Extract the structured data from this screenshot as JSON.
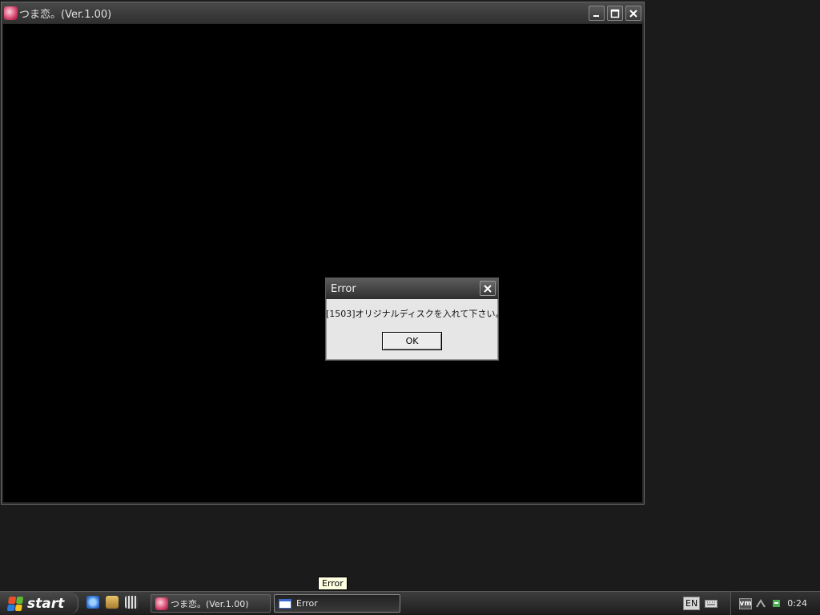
{
  "main_window": {
    "title": "つま恋。(Ver.1.00)"
  },
  "dialog": {
    "title": "Error",
    "message": "[1503]オリジナルディスクを入れて下さい。",
    "ok_label": "OK"
  },
  "tooltip": {
    "text": "Error"
  },
  "taskbar": {
    "start_label": "start",
    "tasks": [
      {
        "label": "つま恋。(Ver.1.00)"
      },
      {
        "label": "Error"
      }
    ],
    "language": "EN",
    "tray_vm_label": "vm",
    "clock": "0:24"
  },
  "colors": {
    "desktop": "#1b1b1b",
    "client_area": "#000000",
    "dialog_body": "#e6e6e6",
    "tooltip_bg": "#ffffe1"
  },
  "icons": {
    "app": "pink-character-icon",
    "minimize": "minimize-icon",
    "maximize": "maximize-icon",
    "close": "close-icon",
    "windows_logo": "windows-logo-icon",
    "ie": "internet-explorer-icon",
    "explorer": "folder-explorer-icon",
    "media": "media-icon",
    "keyboard": "keyboard-icon",
    "network": "network-icon",
    "safely_remove": "safely-remove-hardware-icon"
  }
}
